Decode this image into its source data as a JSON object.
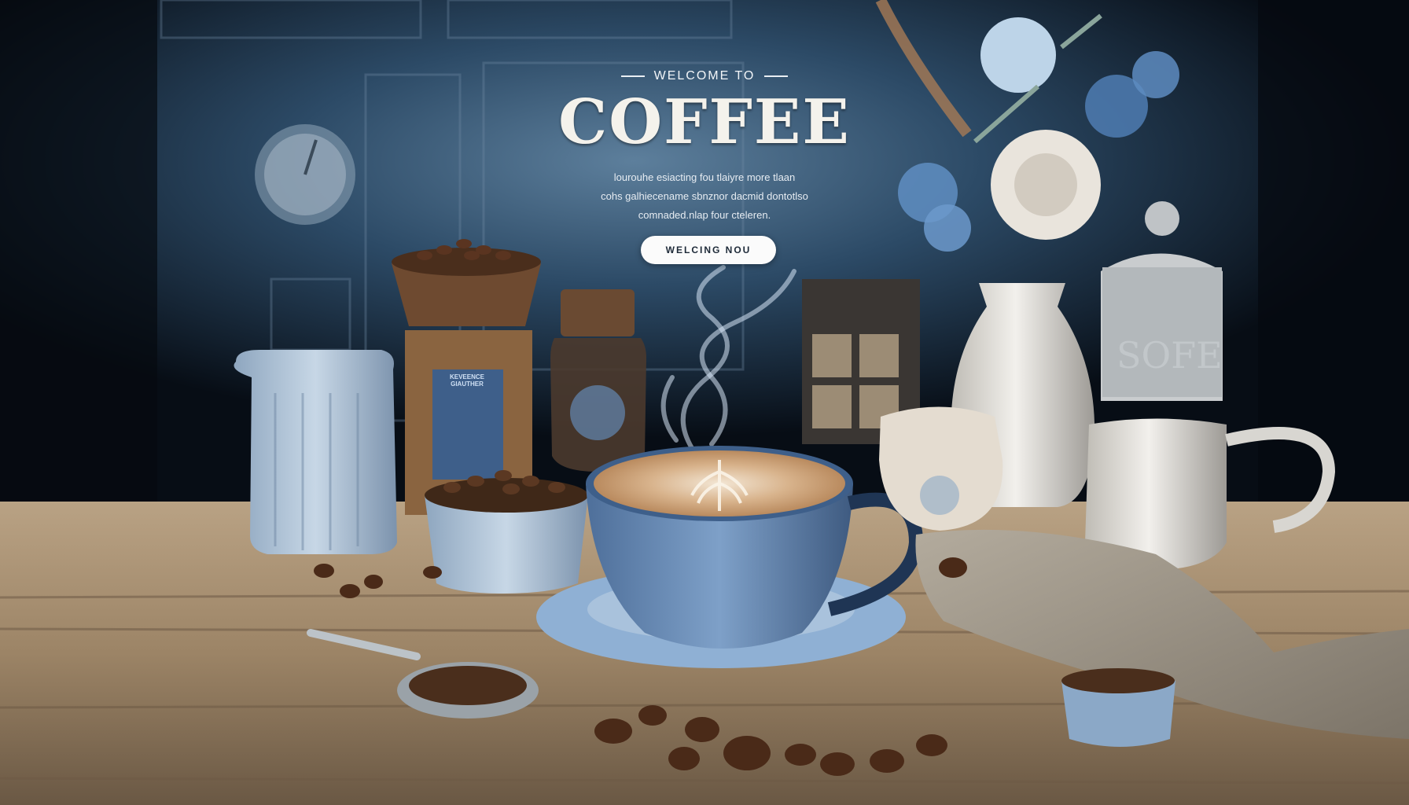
{
  "hero": {
    "eyebrow": "WELCOME TO",
    "title": "COFFEE",
    "description_lines": [
      "lourouhe esiacting fou tlaiyre more tlaan",
      "cohs galhiecename sbnznor dacmid dontotlso",
      "comnaded.nlap four cteleren."
    ],
    "cta_label": "WELCING NOU"
  },
  "props": {
    "jar_label": "KEVEENCE GIAUTHER",
    "tin_label": "SOFE"
  },
  "colors": {
    "background": "#0b1420",
    "wall_blue": "#2a4a66",
    "table_wood": "#a38b6b",
    "cup_blue": "#6f92bd",
    "latte_foam": "#c99f77",
    "button_bg": "#fbfbfb"
  }
}
